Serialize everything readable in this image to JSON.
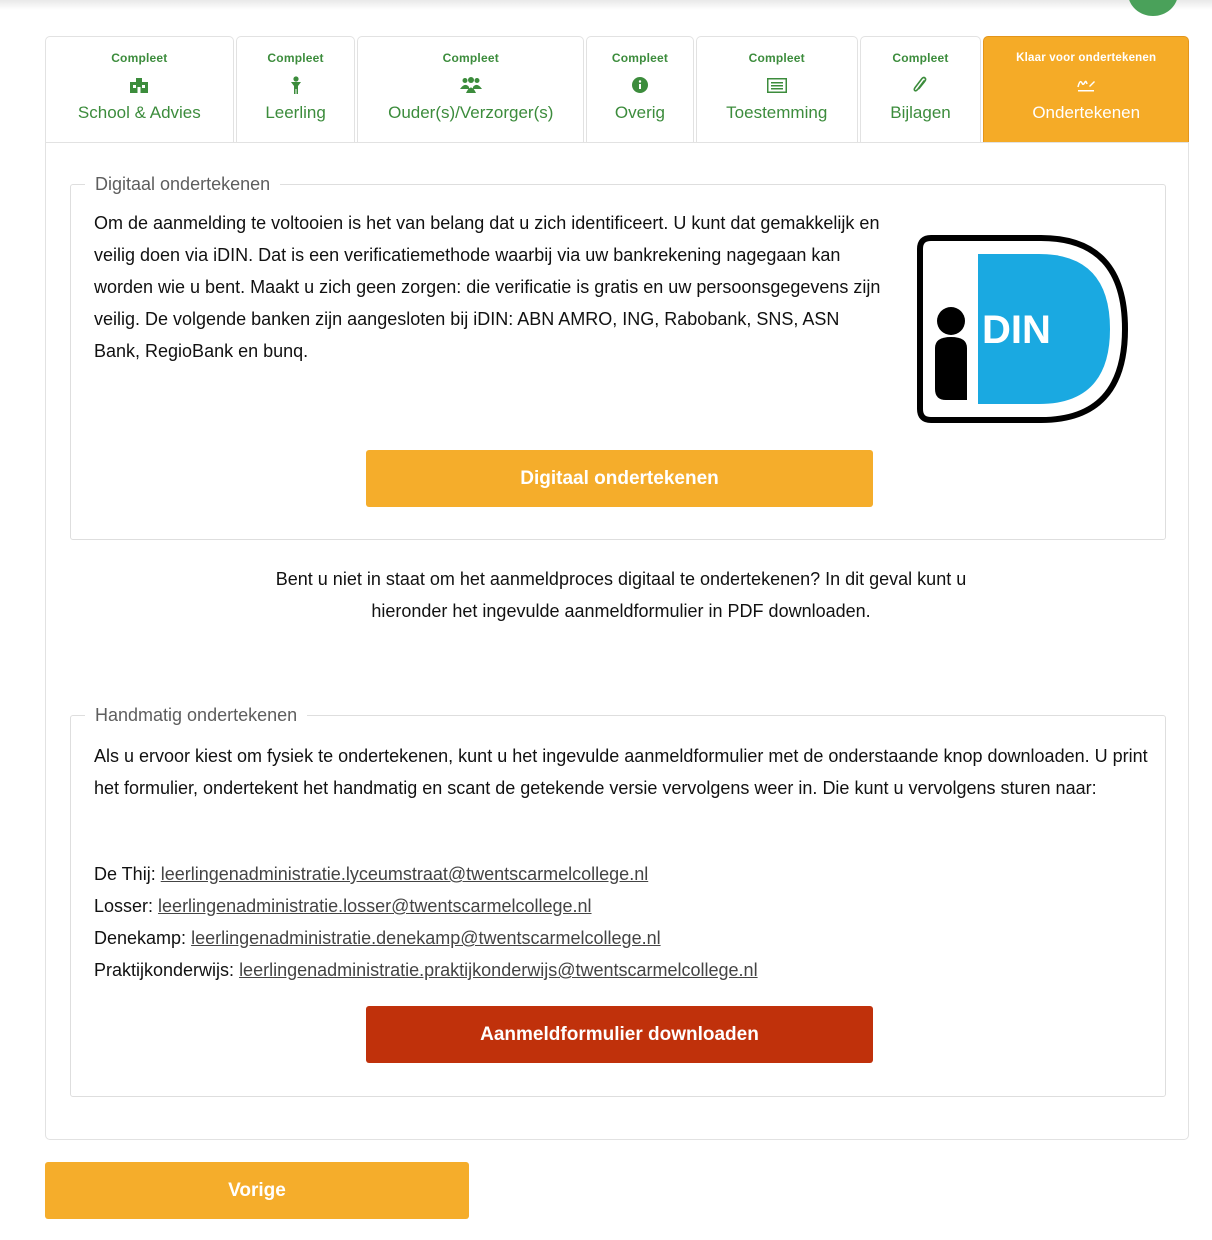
{
  "colors": {
    "primary": "#f5ad2b",
    "danger": "#c0310b",
    "complete_green": "#3c8c3c",
    "idin_blue": "#1aa9e1"
  },
  "tabs": [
    {
      "status": "Compleet",
      "label": "School & Advies",
      "icon": "school-icon"
    },
    {
      "status": "Compleet",
      "label": "Leerling",
      "icon": "student-icon"
    },
    {
      "status": "Compleet",
      "label": "Ouder(s)/Verzorger(s)",
      "icon": "users-icon"
    },
    {
      "status": "Compleet",
      "label": "Overig",
      "icon": "info-icon"
    },
    {
      "status": "Compleet",
      "label": "Toestemming",
      "icon": "list-icon"
    },
    {
      "status": "Compleet",
      "label": "Bijlagen",
      "icon": "paperclip-icon"
    },
    {
      "status": "Klaar voor ondertekenen",
      "label": "Ondertekenen",
      "icon": "signature-icon"
    }
  ],
  "digital": {
    "legend": "Digitaal ondertekenen",
    "text": "Om de aanmelding te voltooien is het van belang dat u zich identificeert. U kunt dat gemakkelijk en veilig doen via iDIN. Dat is een verificatiemethode waarbij via uw bankrekening nagegaan kan worden wie u bent. Maakt u zich geen zorgen: die verificatie is gratis en uw persoonsgegevens zijn veilig. De volgende banken zijn aangesloten bij iDIN: ABN AMRO, ING, Rabobank, SNS, ASN Bank, RegioBank en bunq.",
    "logo_text": "DIN",
    "button": "Digitaal ondertekenen"
  },
  "middle_text": "Bent u niet in staat om het aanmeldproces digitaal te ondertekenen? In dit geval kunt u hieronder het ingevulde aanmeldformulier in PDF downloaden.",
  "manual": {
    "legend": "Handmatig ondertekenen",
    "text": "Als u ervoor kiest om fysiek te ondertekenen, kunt u het ingevulde aanmeldformulier met de onderstaande knop downloaden. U print het formulier, ondertekent het handmatig en scant de getekende versie vervolgens weer in. Die kunt u vervolgens sturen naar:",
    "contacts": [
      {
        "label": "De Thij:",
        "email": "leerlingenadministratie.lyceumstraat@twentscarmelcollege.nl"
      },
      {
        "label": "Losser:",
        "email": "leerlingenadministratie.losser@twentscarmelcollege.nl"
      },
      {
        "label": "Denekamp:",
        "email": "leerlingenadministratie.denekamp@twentscarmelcollege.nl"
      },
      {
        "label": "Praktijkonderwijs:",
        "email": "leerlingenadministratie.praktijkonderwijs@twentscarmelcollege.nl"
      }
    ],
    "button": "Aanmeldformulier downloaden"
  },
  "prev_button": "Vorige"
}
